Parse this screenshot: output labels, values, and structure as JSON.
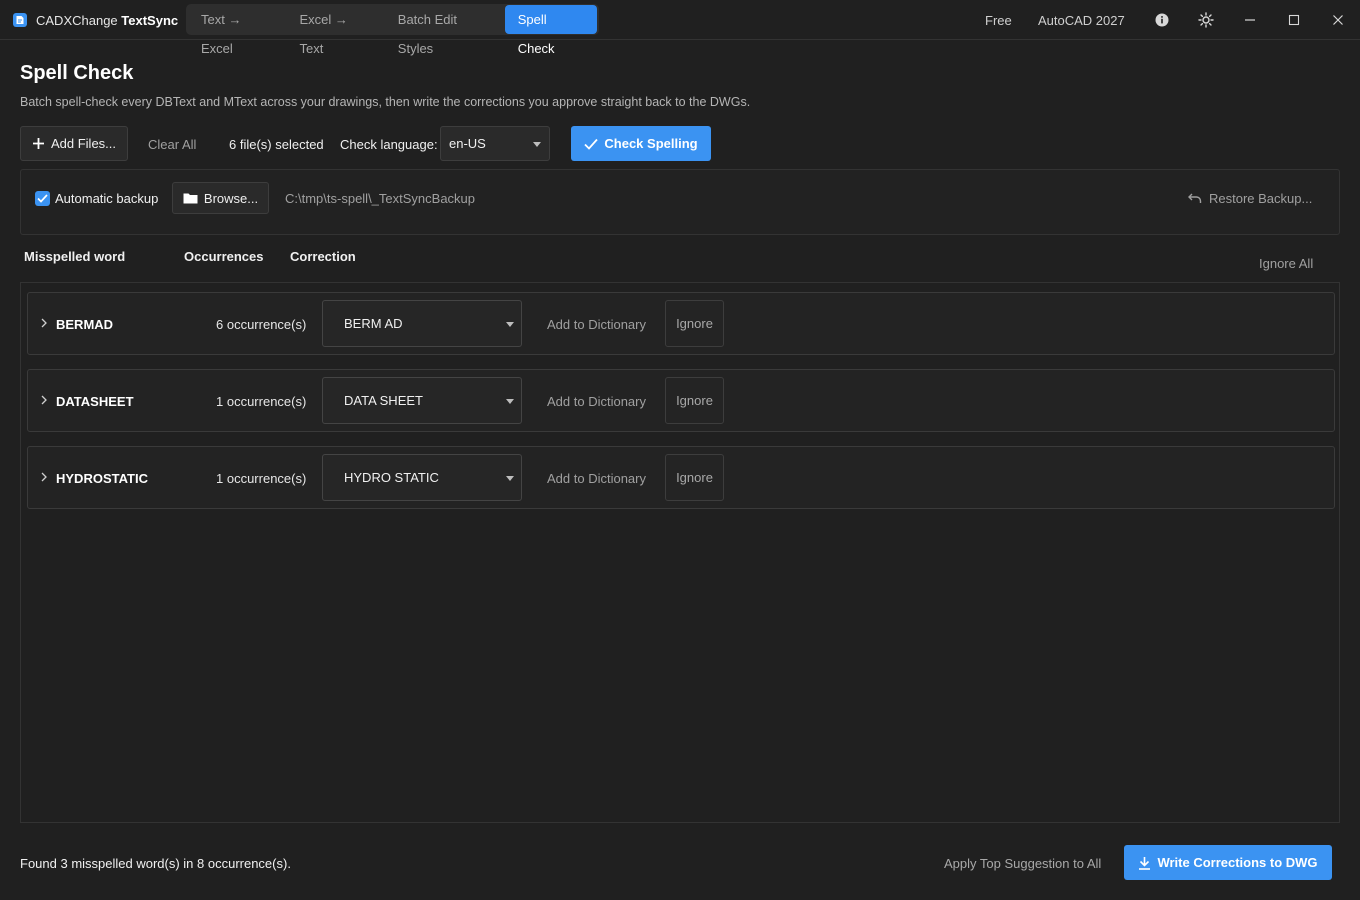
{
  "app": {
    "name_prefix": "CADXChange",
    "name_bold": "TextSync",
    "tabs": [
      {
        "label": "Text → Excel",
        "active": false
      },
      {
        "label": "Excel → Text",
        "active": false
      },
      {
        "label": "Batch Edit Styles",
        "active": false
      },
      {
        "label": "Spell Check",
        "active": true
      }
    ],
    "plan": "Free",
    "cad_version": "AutoCAD 2027",
    "icons": [
      "info-icon",
      "theme-toggle-icon",
      "minimize-icon",
      "maximize-icon",
      "close-icon"
    ]
  },
  "header": {
    "title": "Spell Check",
    "subtitle": "Batch spell-check every DBText and MText across your drawings, then write the corrections you approve straight back to the DWGs."
  },
  "toolbar": {
    "add_files": "Add Files...",
    "clear_all": "Clear All",
    "files_selected": "6 file(s) selected",
    "language_label": "Check language:",
    "language_value": "en-US",
    "check_spelling": "Check Spelling"
  },
  "backup": {
    "checked": true,
    "label": "Automatic backup",
    "browse": "Browse...",
    "path": "C:\\tmp\\ts-spell\\_TextSyncBackup",
    "restore": "Restore Backup..."
  },
  "columns": {
    "word": "Misspelled word",
    "occurrences": "Occurrences",
    "correction": "Correction",
    "ignore_all": "Ignore All"
  },
  "rows": [
    {
      "word": "BERMAD",
      "occurrences": "6 occurrence(s)",
      "correction": "BERM AD",
      "add_dict": "Add to Dictionary",
      "ignore": "Ignore"
    },
    {
      "word": "DATASHEET",
      "occurrences": "1 occurrence(s)",
      "correction": "DATA SHEET",
      "add_dict": "Add to Dictionary",
      "ignore": "Ignore"
    },
    {
      "word": "HYDROSTATIC",
      "occurrences": "1 occurrence(s)",
      "correction": "HYDRO STATIC",
      "add_dict": "Add to Dictionary",
      "ignore": "Ignore"
    }
  ],
  "footer": {
    "status": "Found 3 misspelled word(s) in 8 occurrence(s).",
    "apply_top": "Apply Top Suggestion to All",
    "write": "Write Corrections to DWG"
  },
  "colors": {
    "accent": "#3b93f2",
    "background": "#202020"
  }
}
